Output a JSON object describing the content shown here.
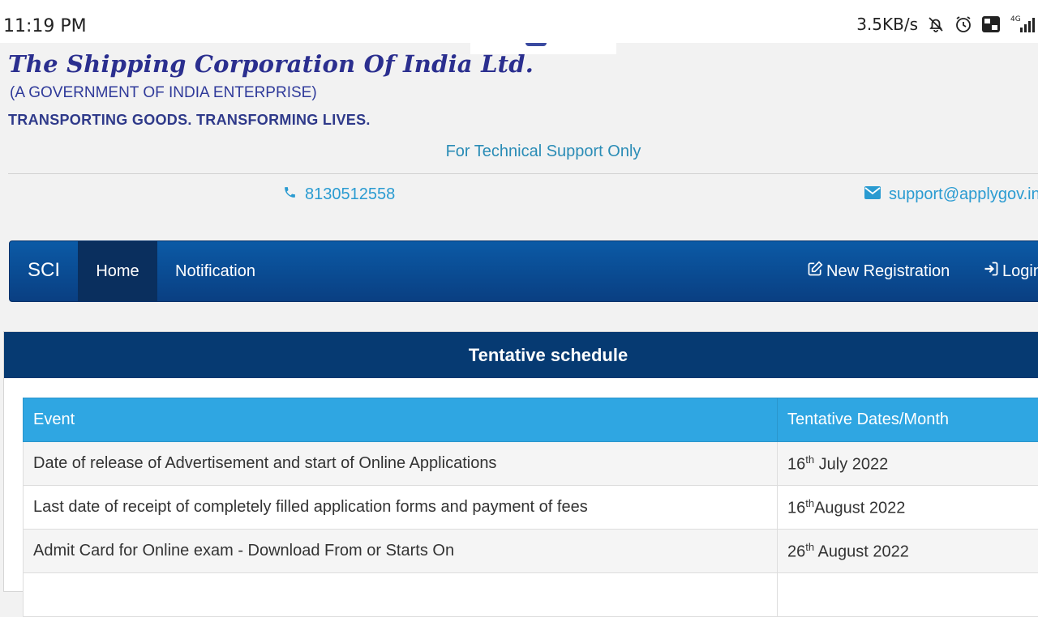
{
  "status_bar": {
    "time": "11:19 PM",
    "network_speed": "3.5KB/s",
    "icons": [
      "notifications-off-icon",
      "alarm-icon",
      "volte-icon",
      "signal-4g-icon"
    ]
  },
  "header": {
    "org_name": "The Shipping Corporation Of India Ltd.",
    "org_subtitle": "(A GOVERNMENT OF INDIA ENTERPRISE)",
    "tagline": "TRANSPORTING GOODS. TRANSFORMING LIVES.",
    "tech_support": "For Technical Support Only",
    "phone": "8130512558",
    "email": "support@applygov.in"
  },
  "navbar": {
    "brand": "SCI",
    "items": [
      "Home",
      "Notification"
    ],
    "active": "Home",
    "new_registration": "New Registration",
    "login": "Login"
  },
  "schedule": {
    "title": "Tentative schedule",
    "columns": [
      "Event",
      "Tentative Dates/Month"
    ],
    "rows": [
      {
        "event": "Date of release of Advertisement and start of Online Applications",
        "day": "16",
        "suffix": "th",
        "rest": " July 2022"
      },
      {
        "event": "Last date of receipt of completely filled application forms and payment of fees",
        "day": "16",
        "suffix": "th",
        "rest": "August 2022"
      },
      {
        "event": "Admit Card for Online exam - Download From or Starts On",
        "day": "26",
        "suffix": "th",
        "rest": " August 2022"
      }
    ]
  },
  "colors": {
    "navbar": "#0a4a93",
    "panel_header": "#063a72",
    "table_header": "#2fa6e2",
    "link": "#2a9bd1"
  }
}
